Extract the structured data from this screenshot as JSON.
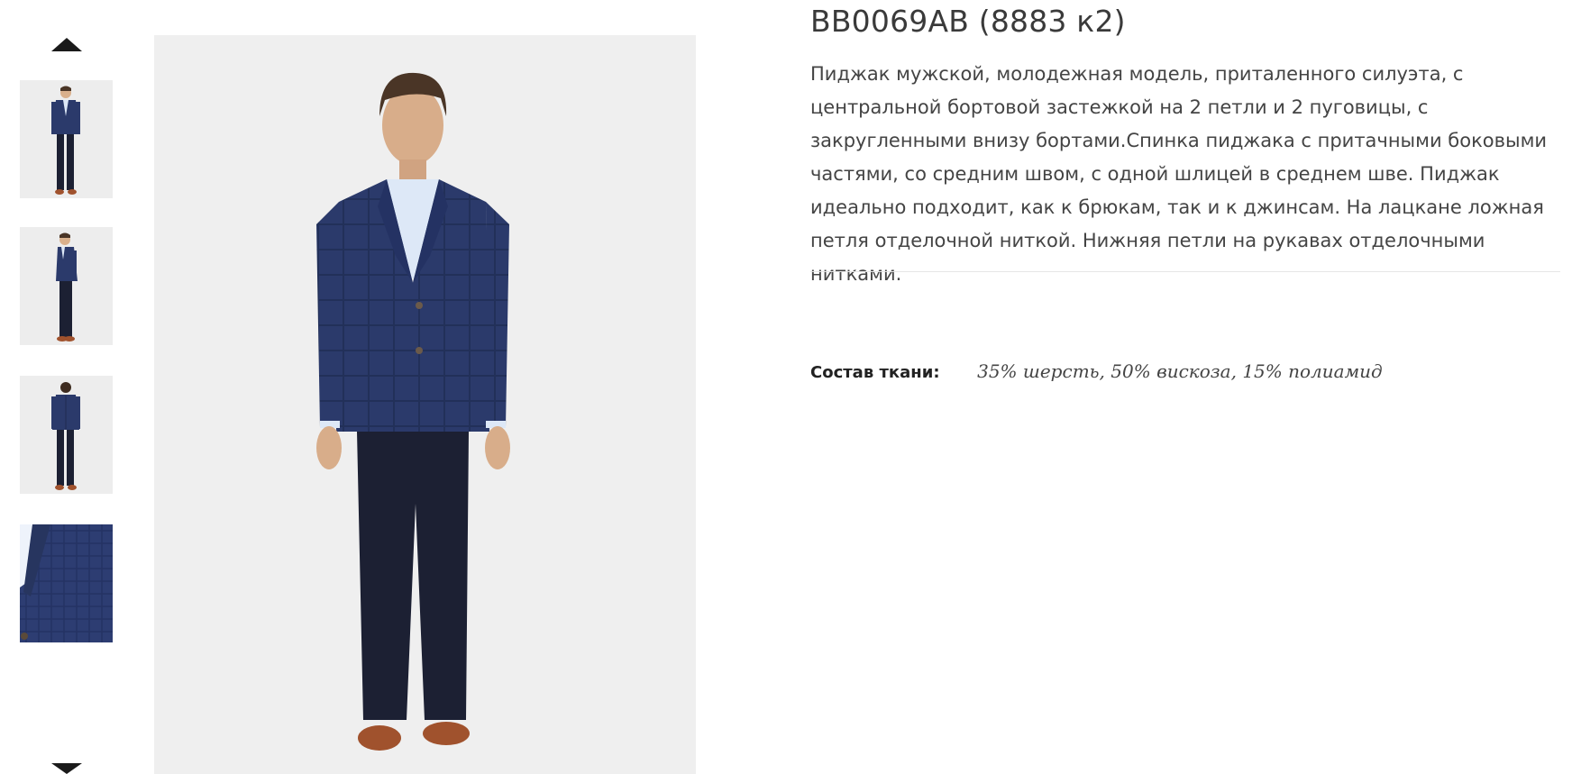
{
  "gallery": {
    "prev_icon": "triangle-up-icon",
    "next_icon": "triangle-down-icon",
    "thumbnails": [
      {
        "view": "front"
      },
      {
        "view": "side"
      },
      {
        "view": "back"
      },
      {
        "view": "closeup"
      }
    ]
  },
  "product": {
    "title": "BB0069AB (8883 к2)",
    "description": "Пиджак мужской, молодежная модель, приталенного силуэта, с центральной бортовой застежкой на 2 петли и 2 пуговицы, с закругленными внизу бортами.Спинка пиджака с притачными боковыми частями, со средним швом, с одной шлицей в среднем шве. Пиджак идеально подходит, как к брюкам, так и к джинсам. На лацкане ложная петля отделочной ниткой. Нижняя петли на рукавах отделочными нитками.",
    "composition_label": "Состав ткани:",
    "composition_value": "35% шерсть, 50% вискоза, 15% полиамид"
  },
  "colors": {
    "jacket": "#2b3a6b",
    "trousers": "#1c2033",
    "shirt": "#dde8f7",
    "shoes": "#a0522d",
    "image_bg": "#efefef"
  }
}
